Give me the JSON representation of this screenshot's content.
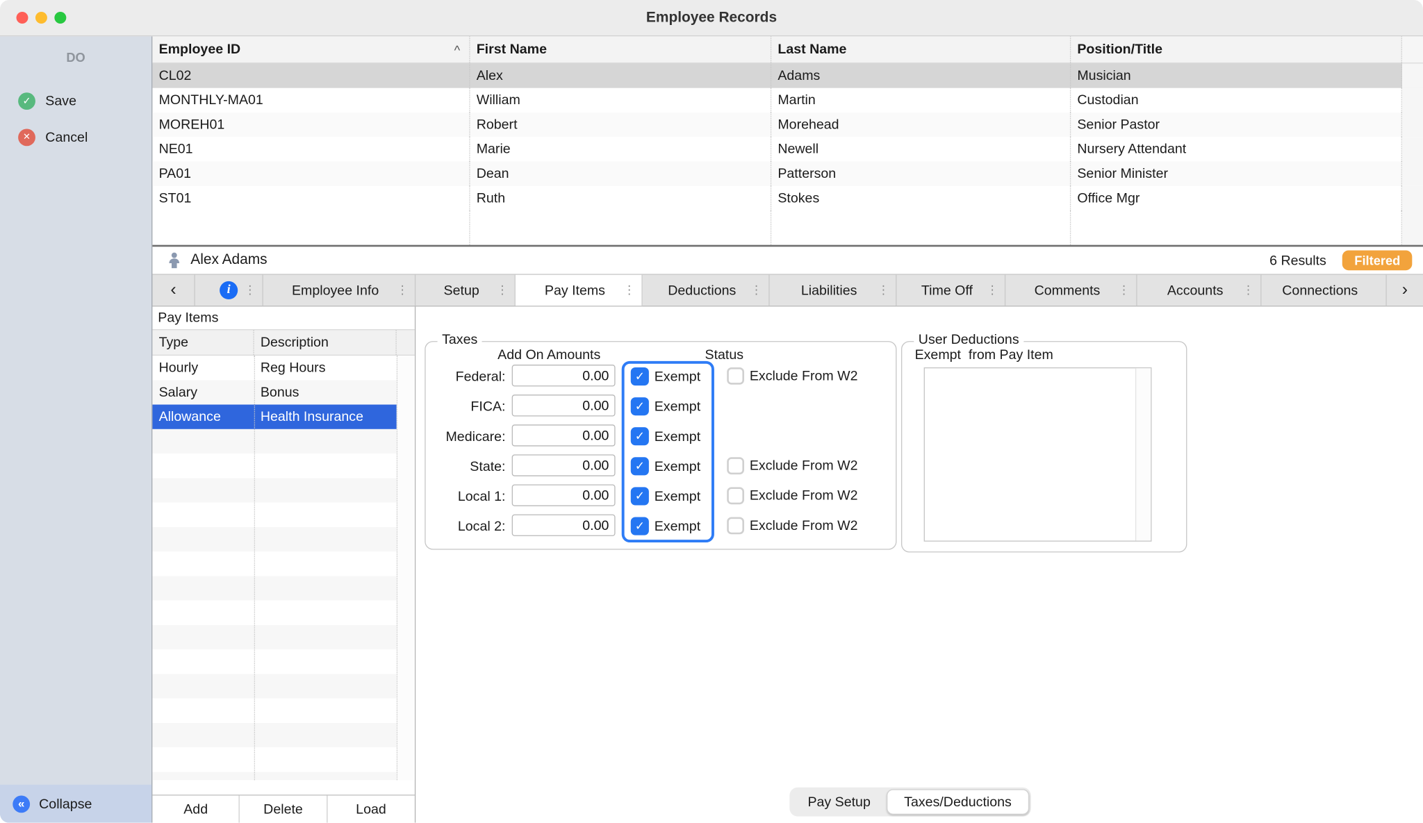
{
  "window": {
    "title": "Employee Records"
  },
  "sidebar": {
    "header": "DO",
    "save_label": "Save",
    "cancel_label": "Cancel",
    "collapse_label": "Collapse"
  },
  "employee_table": {
    "columns": [
      "Employee ID",
      "First Name",
      "Last Name",
      "Position/Title"
    ],
    "sorted_column": "Employee ID",
    "selected_row_index": 0,
    "rows": [
      [
        "CL02",
        "Alex",
        "Adams",
        "Musician"
      ],
      [
        "MONTHLY-MA01",
        "William",
        "Martin",
        "Custodian"
      ],
      [
        "MOREH01",
        "Robert",
        "Morehead",
        "Senior Pastor"
      ],
      [
        "NE01",
        "Marie",
        "Newell",
        "Nursery Attendant"
      ],
      [
        "PA01",
        "Dean",
        "Patterson",
        "Senior Minister"
      ],
      [
        "ST01",
        "Ruth",
        "Stokes",
        "Office Mgr"
      ]
    ]
  },
  "record_bar": {
    "employee_name": "Alex Adams",
    "results_count": "6 Results",
    "filter_badge": "Filtered"
  },
  "tabs": {
    "back": "‹",
    "forward": "›",
    "items": [
      "Employee Info",
      "Setup",
      "Pay Items",
      "Deductions",
      "Liabilities",
      "Time Off",
      "Comments",
      "Accounts",
      "Connections"
    ],
    "selected": "Pay Items"
  },
  "pay_items": {
    "title": "Pay Items",
    "columns": [
      "Type",
      "Description"
    ],
    "selected_row_index": 2,
    "rows": [
      [
        "Hourly",
        "Reg Hours"
      ],
      [
        "Salary",
        "Bonus"
      ],
      [
        "Allowance",
        "Health Insurance"
      ]
    ],
    "buttons": [
      "Add",
      "Delete",
      "Load"
    ]
  },
  "taxes": {
    "group_label": "Taxes",
    "add_on_header": "Add On Amounts",
    "status_header": "Status",
    "exempt_label": "Exempt",
    "exclude_label": "Exclude From W2",
    "rows": [
      {
        "label": "Federal:",
        "amount": "0.00",
        "exempt_checked": true,
        "has_exclude": true,
        "exclude_checked": false
      },
      {
        "label": "FICA:",
        "amount": "0.00",
        "exempt_checked": true,
        "has_exclude": false
      },
      {
        "label": "Medicare:",
        "amount": "0.00",
        "exempt_checked": true,
        "has_exclude": false
      },
      {
        "label": "State:",
        "amount": "0.00",
        "exempt_checked": true,
        "has_exclude": true,
        "exclude_checked": false
      },
      {
        "label": "Local 1:",
        "amount": "0.00",
        "exempt_checked": true,
        "has_exclude": true,
        "exclude_checked": false
      },
      {
        "label": "Local 2:",
        "amount": "0.00",
        "exempt_checked": true,
        "has_exclude": true,
        "exclude_checked": false
      }
    ]
  },
  "user_deductions": {
    "group_label": "User Deductions",
    "list_label": "Exempt  from Pay Item",
    "items": []
  },
  "bottom_tabs": {
    "items": [
      "Pay Setup",
      "Taxes/Deductions"
    ],
    "selected": "Taxes/Deductions"
  },
  "colors": {
    "accent_blue": "#2e7cf6",
    "selected_row_blue": "#2f66dd",
    "filtered_orange": "#f2a33c"
  }
}
